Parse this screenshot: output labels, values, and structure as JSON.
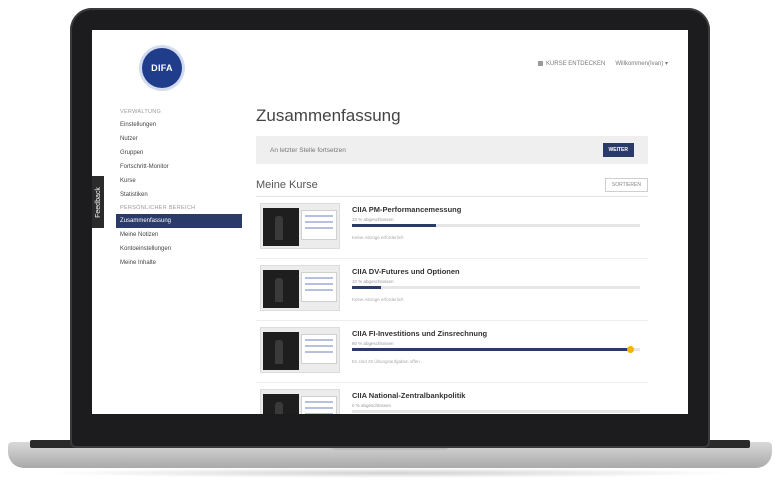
{
  "logo": {
    "text": "DIFA"
  },
  "header": {
    "kurse_entdecken": "KURSE ENTDECKEN",
    "user_menu": "Willkommen(Ivan) ▾"
  },
  "feedback_tab": "Feedback",
  "sidebar": {
    "section1": "VERWALTUNG",
    "items1": [
      "Einstellungen",
      "Nutzer",
      "Gruppen",
      "Fortschritt-Monitor",
      "Kurse",
      "Statistiken"
    ],
    "section2": "PERSÖNLICHER BEREICH",
    "items2": [
      "Zusammenfassung",
      "Meine Notizen",
      "Kontoeinstellungen",
      "Meine Inhalte"
    ]
  },
  "main": {
    "title": "Zusammenfassung",
    "resume_text": "An letzter Stelle fortsetzen",
    "resume_button": "WEITER",
    "kurse_title": "Meine Kurse",
    "sort_button": "SORTIEREN",
    "courses": [
      {
        "name": "CIIA PM-Performancemessung",
        "progress_label": "33 % abgeschlossen",
        "progress": 0.29,
        "note": "Keine Abzüge erforderlich"
      },
      {
        "name": "CIIA DV-Futures und Optionen",
        "progress_label": "10 % abgeschlossen",
        "progress": 0.1,
        "note": "Keine Abzüge erforderlich"
      },
      {
        "name": "CIIA FI-Investitions und Zinsrechnung",
        "progress_label": "80 % abgeschlossen",
        "progress": 0.97,
        "note": "Es sind 26 Übungsaufgaben offen"
      },
      {
        "name": "CIIA National-Zentralbankpolitik",
        "progress_label": "0 % abgeschlossen",
        "progress": 0.0,
        "note": ""
      }
    ]
  },
  "colors": {
    "accent": "#2a3b6a",
    "marker": "#f2b400"
  }
}
